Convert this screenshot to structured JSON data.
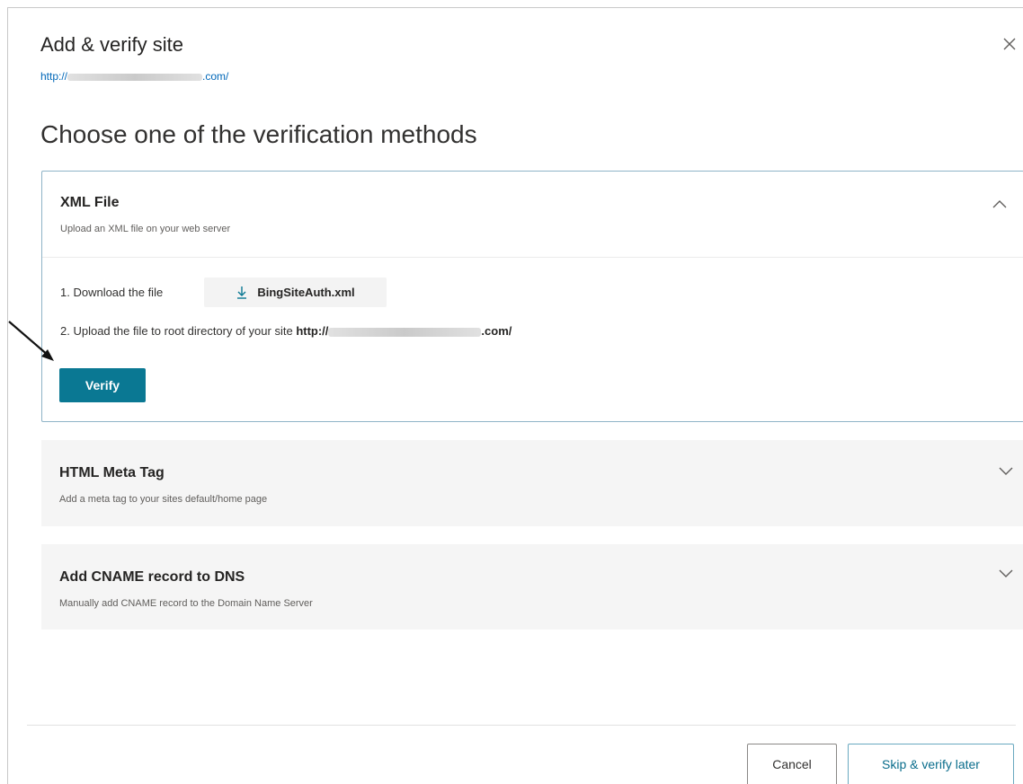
{
  "dialog": {
    "title": "Add & verify site",
    "site_url_prefix": "http://",
    "site_url_suffix": ".com/",
    "close_icon": "close-icon",
    "subtitle": "Choose one of the verification methods"
  },
  "methods": [
    {
      "title": "XML File",
      "description": "Upload an XML file on your web server",
      "expanded": true,
      "chevron": "chevron-up-icon",
      "step1_label": "1. Download the file",
      "download_file": "BingSiteAuth.xml",
      "download_icon": "download-icon",
      "step2_label": "2. Upload the file to root directory of your site",
      "step2_url_prefix": "http://",
      "step2_url_suffix": ".com/",
      "verify_label": "Verify"
    },
    {
      "title": "HTML Meta Tag",
      "description": "Add a meta tag to your sites default/home page",
      "expanded": false,
      "chevron": "chevron-down-icon"
    },
    {
      "title": "Add CNAME record to DNS",
      "description": "Manually add CNAME record to the Domain Name Server",
      "expanded": false,
      "chevron": "chevron-down-icon"
    }
  ],
  "footer": {
    "cancel_label": "Cancel",
    "skip_label": "Skip & verify later"
  },
  "colors": {
    "accent": "#0a7893",
    "link": "#0067b8",
    "panel_border": "#8fb4c7",
    "collapsed_bg": "#f5f5f5"
  }
}
